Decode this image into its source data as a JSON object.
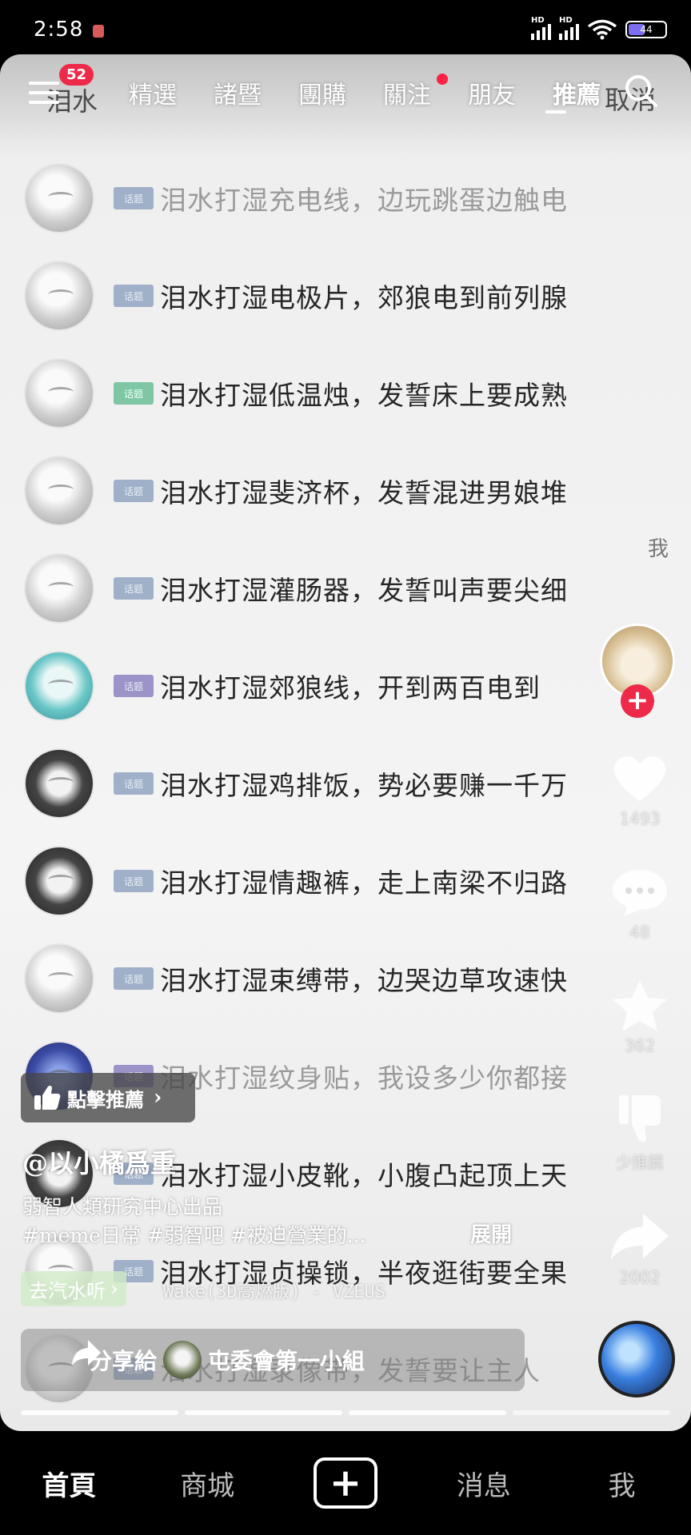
{
  "status_bar": {
    "time": "2:58",
    "battery": "44"
  },
  "nav": {
    "badge": "52",
    "ghost_search": "泪水",
    "tabs": [
      "精選",
      "諸暨",
      "團購",
      "關注",
      "朋友",
      "推薦"
    ],
    "active_tab": "推薦",
    "ghost_cancel": "取消"
  },
  "search_list": {
    "items": [
      {
        "tag": "话题",
        "text": "泪水打湿充电线，边玩跳蛋边触电"
      },
      {
        "tag": "话题",
        "text": "泪水打湿电极片，郊狼电到前列腺"
      },
      {
        "tag": "话题",
        "text": "泪水打湿低温烛，发誓床上要成熟"
      },
      {
        "tag": "话题",
        "text": "泪水打湿斐济杯，发誓混进男娘堆"
      },
      {
        "tag": "话题",
        "text": "泪水打湿灌肠器，发誓叫声要尖细"
      },
      {
        "tag": "话题",
        "text": "泪水打湿郊狼线，开到两百电到"
      },
      {
        "tag": "话题",
        "text": "泪水打湿鸡排饭，势必要赚一千万"
      },
      {
        "tag": "话题",
        "text": "泪水打湿情趣裤，走上南梁不归路"
      },
      {
        "tag": "话题",
        "text": "泪水打湿束缚带，边哭边草攻速快"
      },
      {
        "tag": "话题",
        "text": "泪水打湿纹身贴，我设多少你都接"
      },
      {
        "tag": "话题",
        "text": "泪水打湿小皮靴，小腹凸起顶上天"
      },
      {
        "tag": "话题",
        "text": "泪水打湿贞操锁，半夜逛街要全果"
      },
      {
        "tag": "话题",
        "text": "泪水打湿录像带，发誓要让主人"
      }
    ],
    "extra_me": "我"
  },
  "actions": {
    "likes": "1493",
    "comments": "48",
    "favorites": "362",
    "dislike_label": "少推薦",
    "shares": "2002"
  },
  "overlay": {
    "recommend_label": "點擊推薦",
    "author": "@以小橘爲重",
    "desc_line1": "弱智人類研究中心出品",
    "desc_tags": "#meme日常 #弱智吧 #被迫營業的...",
    "expand": "展開",
    "music_pill": "去汽水听",
    "music_track": "Wake(3D高燃版) - VZEUS",
    "share_label": "分享給",
    "share_group": "屯委會第一小組"
  },
  "tabbar": {
    "home": "首頁",
    "mall": "商城",
    "create": "+",
    "messages": "消息",
    "me": "我"
  },
  "colors": {
    "accent_red": "#ee2a4a",
    "bg": "#000000"
  }
}
